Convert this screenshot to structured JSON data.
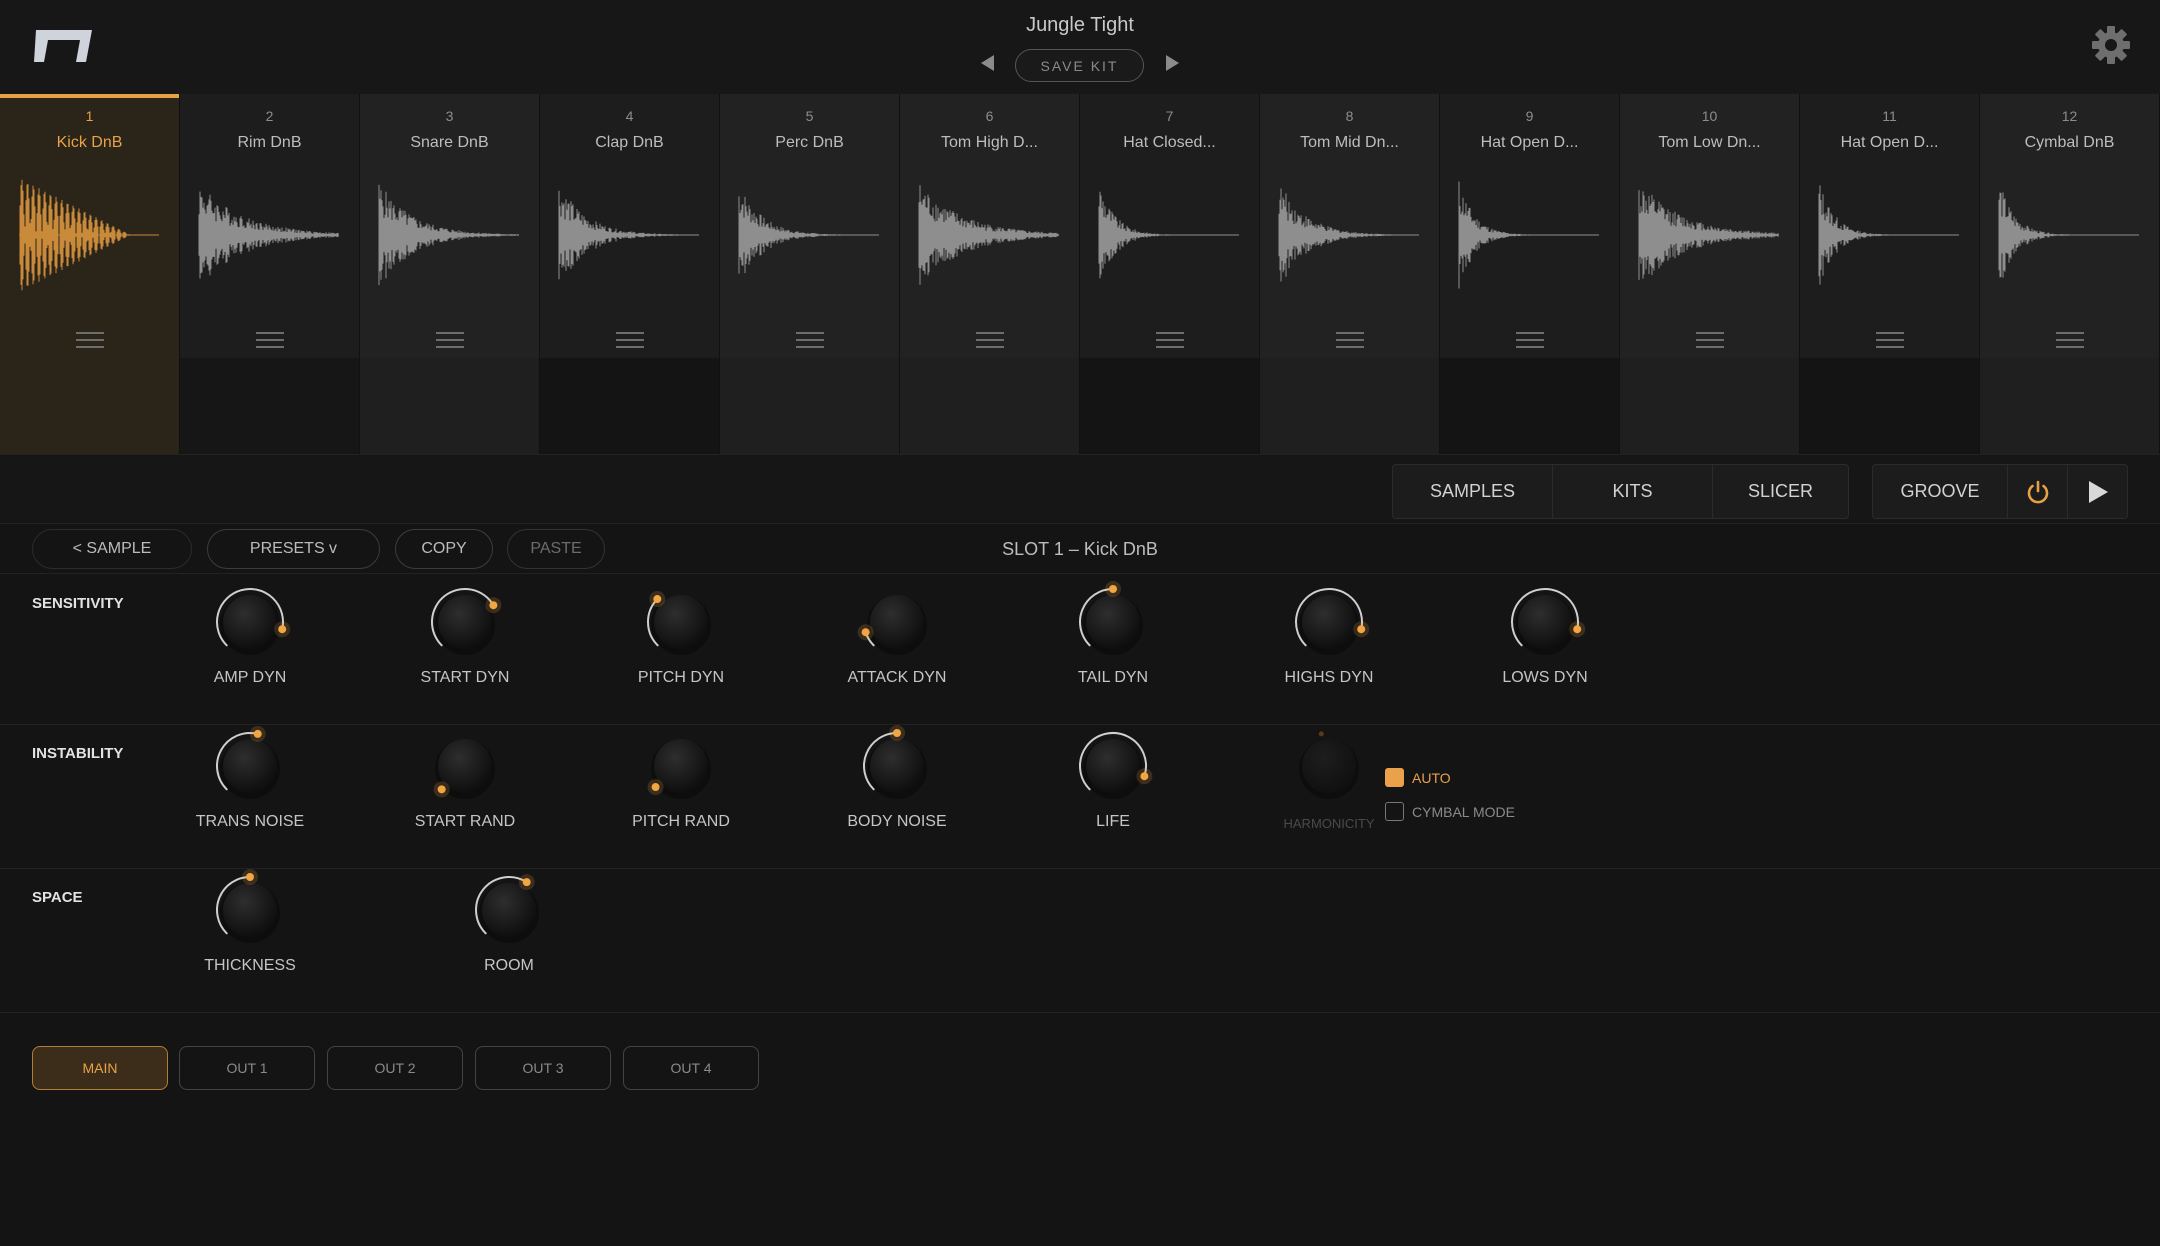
{
  "header": {
    "kit_name": "Jungle Tight",
    "save_kit_label": "SAVE KIT"
  },
  "slots": [
    {
      "num": "1",
      "name": "Kick DnB",
      "selected": true,
      "lower": "#2b2419",
      "upper": "#2b2419"
    },
    {
      "num": "2",
      "name": "Rim DnB",
      "selected": false,
      "lower": "#161616",
      "upper": "#1d1d1d"
    },
    {
      "num": "3",
      "name": "Snare DnB",
      "selected": false,
      "lower": "#1f1f1f",
      "upper": "#222222"
    },
    {
      "num": "4",
      "name": "Clap DnB",
      "selected": false,
      "lower": "#141414",
      "upper": "#1d1d1d"
    },
    {
      "num": "5",
      "name": "Perc DnB",
      "selected": false,
      "lower": "#1f1f1f",
      "upper": "#222222"
    },
    {
      "num": "6",
      "name": "Tom High D...",
      "selected": false,
      "lower": "#1f1f1f",
      "upper": "#222222"
    },
    {
      "num": "7",
      "name": "Hat Closed...",
      "selected": false,
      "lower": "#141414",
      "upper": "#1d1d1d"
    },
    {
      "num": "8",
      "name": "Tom Mid Dn...",
      "selected": false,
      "lower": "#1f1f1f",
      "upper": "#222222"
    },
    {
      "num": "9",
      "name": "Hat Open D...",
      "selected": false,
      "lower": "#141414",
      "upper": "#1d1d1d"
    },
    {
      "num": "10",
      "name": "Tom Low Dn...",
      "selected": false,
      "lower": "#1f1f1f",
      "upper": "#222222"
    },
    {
      "num": "11",
      "name": "Hat Open D...",
      "selected": false,
      "lower": "#141414",
      "upper": "#1d1d1d"
    },
    {
      "num": "12",
      "name": "Cymbal DnB",
      "selected": false,
      "lower": "#1f1f1f",
      "upper": "#222222"
    }
  ],
  "tabs": {
    "samples": "SAMPLES",
    "kits": "KITS",
    "slicer": "SLICER",
    "groove": "GROOVE"
  },
  "actions": {
    "sample": "< SAMPLE",
    "presets": "PRESETS v",
    "copy": "COPY",
    "paste": "PASTE"
  },
  "slot_title": "SLOT 1  –  Kick DnB",
  "sections": {
    "sensitivity": "SENSITIVITY",
    "instability": "INSTABILITY",
    "space": "SPACE"
  },
  "knobs": {
    "amp_dyn": {
      "label": "AMP DYN",
      "value": 0.88
    },
    "start_dyn": {
      "label": "START DYN",
      "value": 0.72
    },
    "pitch_dyn": {
      "label": "PITCH DYN",
      "value": 0.33
    },
    "attack_dyn": {
      "label": "ATTACK DYN",
      "value": 0.1
    },
    "tail_dyn": {
      "label": "TAIL DYN",
      "value": 0.5
    },
    "highs_dyn": {
      "label": "HIGHS DYN",
      "value": 0.88
    },
    "lows_dyn": {
      "label": "LOWS DYN",
      "value": 0.88
    },
    "trans_noise": {
      "label": "TRANS NOISE",
      "value": 0.55
    },
    "start_rand": {
      "label": "START RAND",
      "value": 0.0
    },
    "pitch_rand": {
      "label": "PITCH RAND",
      "value": 0.02
    },
    "body_noise": {
      "label": "BODY NOISE",
      "value": 0.5
    },
    "life": {
      "label": "LIFE",
      "value": 0.9
    },
    "harmonicity": {
      "label": "HARMONICITY",
      "value": 0.45
    },
    "thickness": {
      "label": "THICKNESS",
      "value": 0.5
    },
    "room": {
      "label": "ROOM",
      "value": 0.62
    }
  },
  "checks": {
    "auto": {
      "label": "AUTO",
      "checked": true
    },
    "cymbal_mode": {
      "label": "CYMBAL MODE",
      "checked": false
    }
  },
  "outputs": [
    "MAIN",
    "OUT 1",
    "OUT 2",
    "OUT 3",
    "OUT 4"
  ],
  "colors": {
    "accent": "#e8a044",
    "background": "#141414"
  },
  "icons": {
    "logo": "maker-logo",
    "settings": "gear-icon",
    "power": "power-icon",
    "play": "play-icon"
  }
}
